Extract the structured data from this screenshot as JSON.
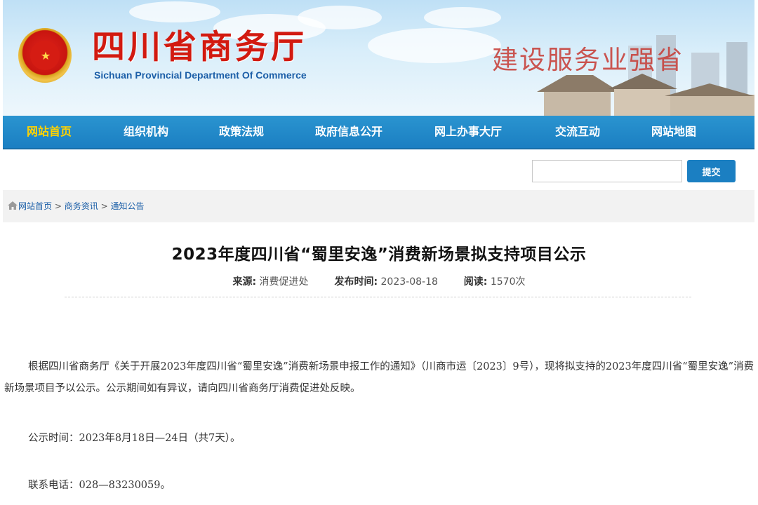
{
  "header": {
    "site_name_cn": "四川省商务厅",
    "site_name_en": "Sichuan Provincial Department Of Commerce",
    "slogan": "建设服务业强省"
  },
  "nav": {
    "items": [
      "网站首页",
      "组织机构",
      "政策法规",
      "政府信息公开",
      "网上办事大厅",
      "交流互动",
      "网站地图"
    ],
    "active_index": 0,
    "active_color": "#ffd200",
    "bar_color": "#1b7fc2"
  },
  "search": {
    "value": "",
    "button_label": "提交"
  },
  "breadcrumb": [
    "网站首页",
    "商务资讯",
    "通知公告"
  ],
  "breadcrumb_separator": ">",
  "article": {
    "title": "2023年度四川省“蜀里安逸”消费新场景拟支持项目公示",
    "source_label": "来源:",
    "source_value": "消费促进处",
    "date_label": "发布时间:",
    "date_value": "2023-08-18",
    "views_label": "阅读:",
    "views_value": "1570次",
    "paragraphs": [
      "根据四川省商务厅《关于开展2023年度四川省“蜀里安逸”消费新场景申报工作的通知》（川商市运〔2023〕9号），现将拟支持的2023年度四川省“蜀里安逸”消费新场景项目予以公示。公示期间如有异议，请向四川省商务厅消费促进处反映。",
      "公示时间：2023年8月18日—24日（共7天）。",
      "联系电话：028—83230059。"
    ]
  }
}
